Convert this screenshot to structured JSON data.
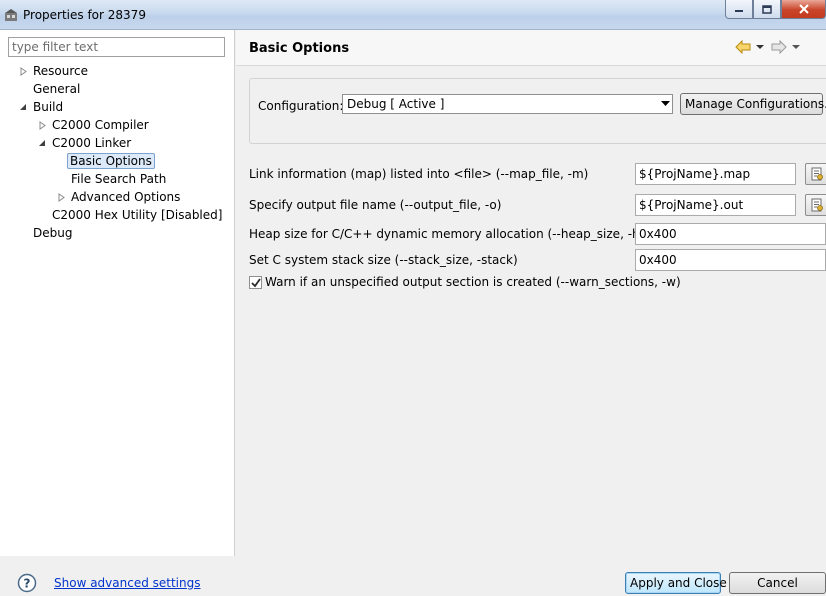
{
  "window": {
    "title": "Properties for 28379"
  },
  "filter": {
    "placeholder": "type filter text"
  },
  "tree": {
    "resource": "Resource",
    "general": "General",
    "build": "Build",
    "c2000_compiler": "C2000 Compiler",
    "c2000_linker": "C2000 Linker",
    "basic_options": "Basic Options",
    "file_search_path": "File Search Path",
    "advanced_options": "Advanced Options",
    "hex_utility": "C2000 Hex Utility  [Disabled]",
    "debug": "Debug"
  },
  "header": {
    "title": "Basic Options"
  },
  "configuration": {
    "label": "Configuration:",
    "selected": "Debug  [ Active ]",
    "manage_label": "Manage Configurations..."
  },
  "options": {
    "map_label": "Link information (map) listed into <file> (--map_file, -m)",
    "map_value": "${ProjName}.map",
    "output_label": "Specify output file name (--output_file, -o)",
    "output_value": "${ProjName}.out",
    "heap_label": "Heap size for C/C++ dynamic memory allocation (--heap_size, -heap)",
    "heap_value": "0x400",
    "stack_label": "Set C system stack size (--stack_size, -stack)",
    "stack_value": "0x400",
    "warn_label": "Warn if an unspecified output section is created (--warn_sections, -w)",
    "warn_checked": true
  },
  "footer": {
    "advanced_link": "Show advanced settings",
    "apply_label": "Apply and Close",
    "cancel_label": "Cancel"
  },
  "colors": {
    "selection": "#dbe9f8",
    "link": "#0033cc",
    "title_bar": "#c8d9ee"
  }
}
